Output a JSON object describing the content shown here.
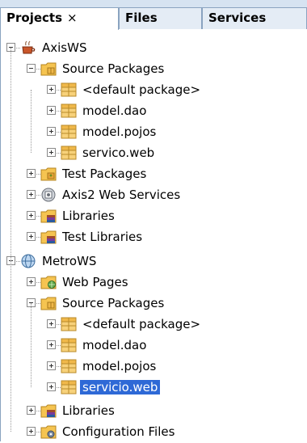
{
  "tabs": [
    {
      "label": "Projects",
      "close": "×",
      "active": true
    },
    {
      "label": "Files",
      "active": false
    },
    {
      "label": "Services",
      "active": false
    }
  ],
  "tree": [
    {
      "label": "AxisWS",
      "icon": "coffee-project-icon",
      "state": "expanded"
    },
    {
      "label": "Source Packages",
      "icon": "source-packages-icon",
      "state": "expanded"
    },
    {
      "label": "<default package>",
      "icon": "package-icon",
      "state": "collapsed"
    },
    {
      "label": "model.dao",
      "icon": "package-icon",
      "state": "collapsed"
    },
    {
      "label": "model.pojos",
      "icon": "package-icon",
      "state": "collapsed"
    },
    {
      "label": "servico.web",
      "icon": "package-icon",
      "state": "collapsed"
    },
    {
      "label": "Test Packages",
      "icon": "test-packages-icon",
      "state": "collapsed"
    },
    {
      "label": "Axis2 Web Services",
      "icon": "web-services-icon",
      "state": "collapsed"
    },
    {
      "label": "Libraries",
      "icon": "libraries-icon",
      "state": "collapsed"
    },
    {
      "label": "Test Libraries",
      "icon": "libraries-icon",
      "state": "collapsed"
    },
    {
      "label": "MetroWS",
      "icon": "globe-project-icon",
      "state": "expanded"
    },
    {
      "label": "Web Pages",
      "icon": "web-pages-icon",
      "state": "collapsed"
    },
    {
      "label": "Source Packages",
      "icon": "source-packages-icon",
      "state": "expanded"
    },
    {
      "label": "<default package>",
      "icon": "package-icon",
      "state": "collapsed"
    },
    {
      "label": "model.dao",
      "icon": "package-icon",
      "state": "collapsed"
    },
    {
      "label": "model.pojos",
      "icon": "package-icon",
      "state": "collapsed"
    },
    {
      "label": "servicio.web",
      "icon": "package-icon",
      "state": "collapsed",
      "selected": true
    },
    {
      "label": "Libraries",
      "icon": "libraries-icon",
      "state": "collapsed"
    },
    {
      "label": "Configuration Files",
      "icon": "config-files-icon",
      "state": "collapsed"
    }
  ],
  "colors": {
    "selection": "#2e69d6",
    "tab_bar": "#d6e3f1",
    "package_orange": "#f0b84a"
  }
}
